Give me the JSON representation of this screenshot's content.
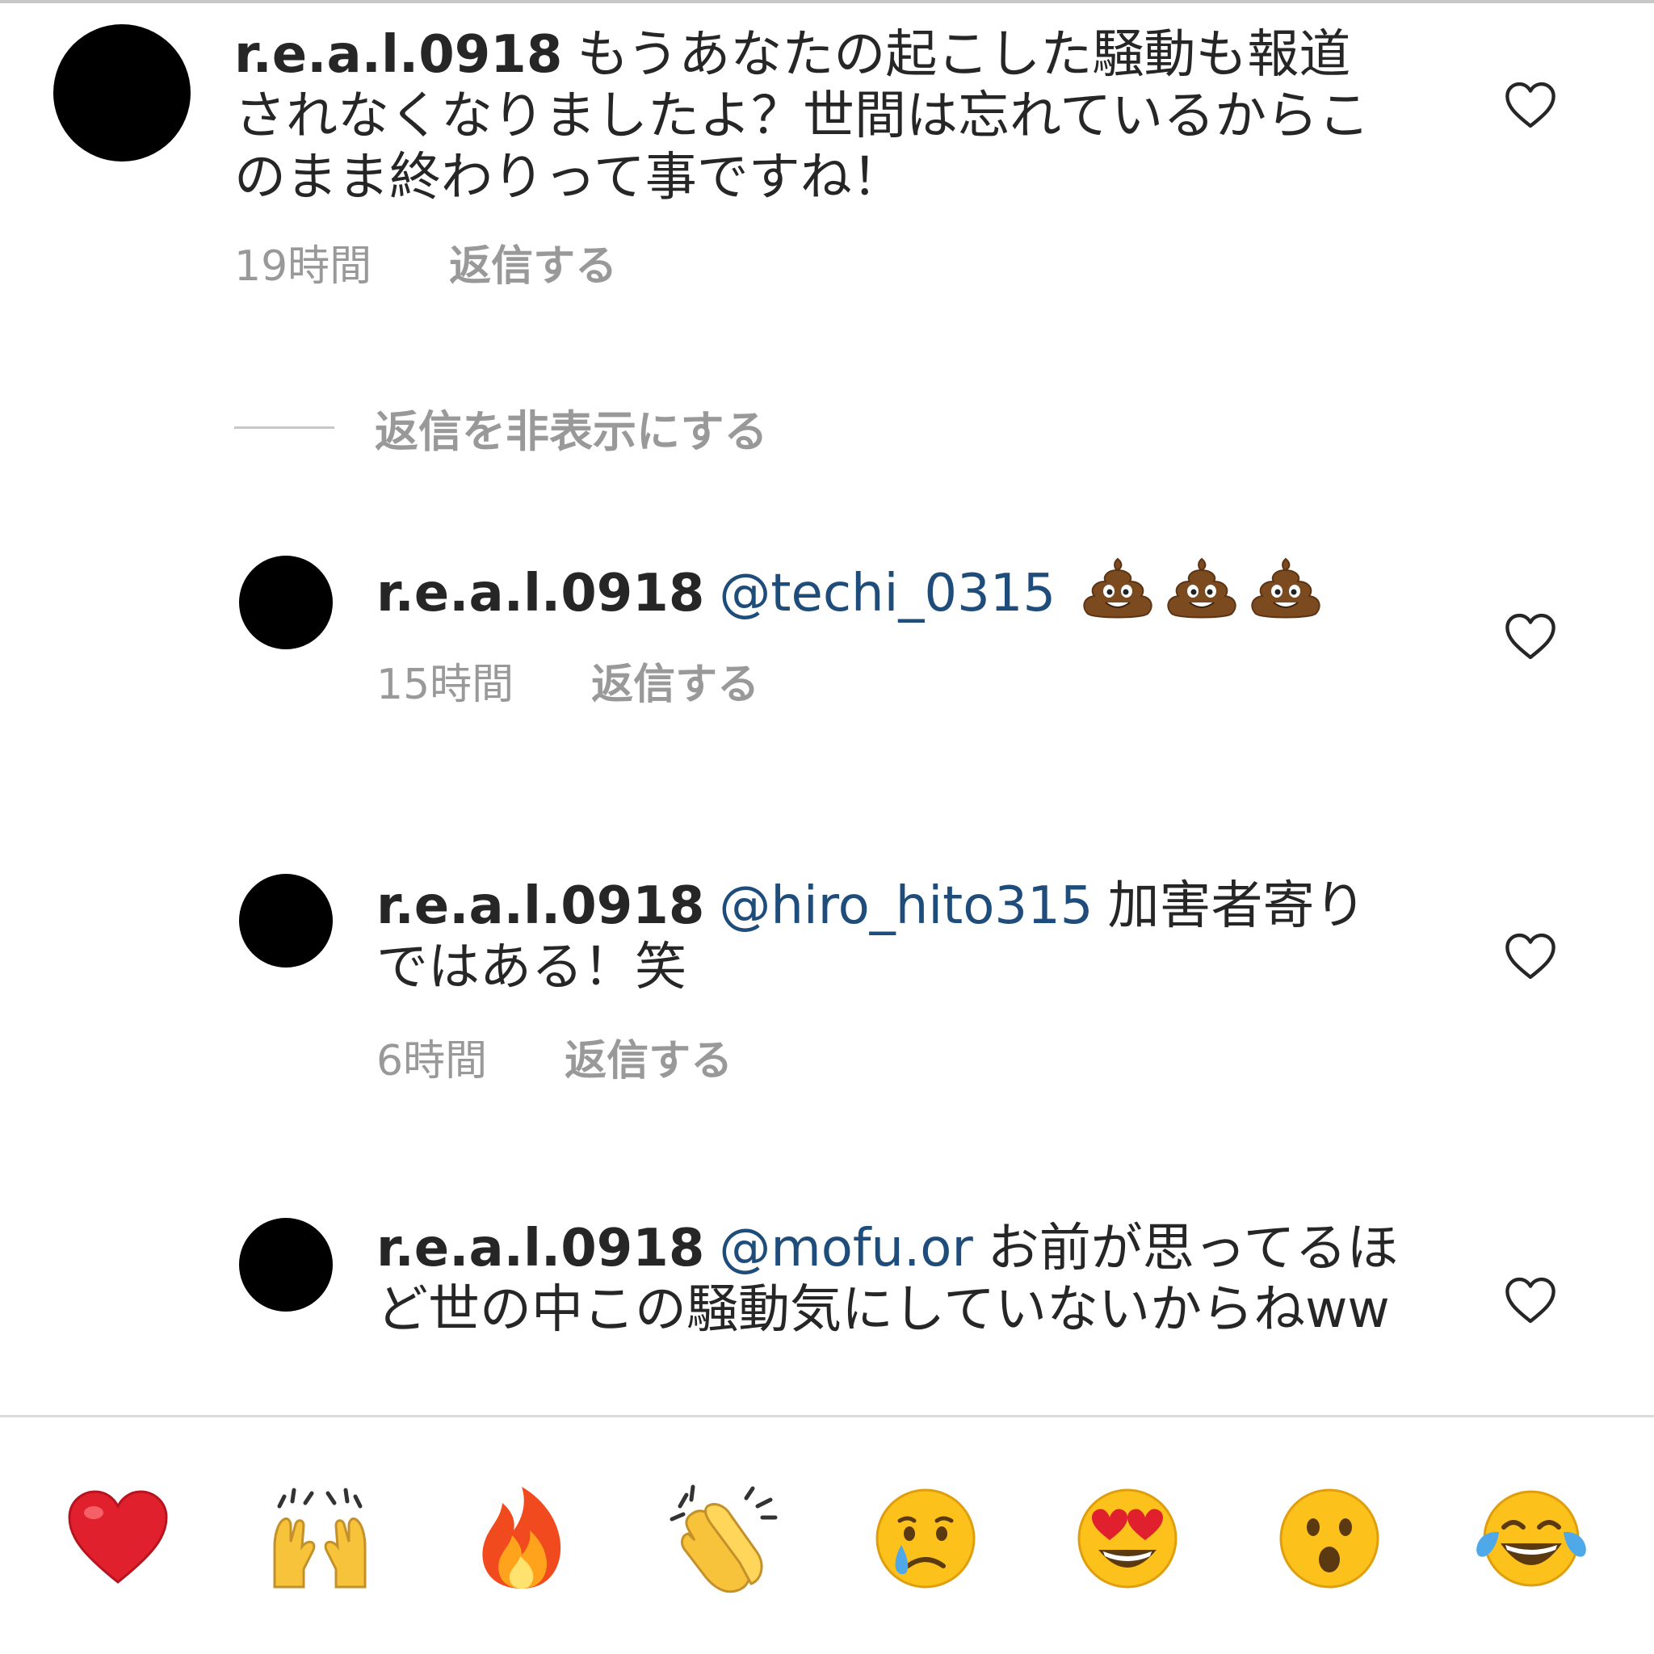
{
  "comments": [
    {
      "username": "r.e.a.l.0918",
      "mention": "",
      "text": "もうあなたの起こした騒動も報道されなくなりましたよ？世間は忘れているからこのまま終わりって事ですね！",
      "time": "19時間",
      "reply_label": "返信する"
    },
    {
      "username": "r.e.a.l.0918",
      "mention": "@techi_0315",
      "text": "",
      "emoji": "pile-of-poo x3",
      "time": "15時間",
      "reply_label": "返信する"
    },
    {
      "username": "r.e.a.l.0918",
      "mention": "@hiro_hito315",
      "text": "加害者寄りではある！笑",
      "time": "6時間",
      "reply_label": "返信する"
    },
    {
      "username": "r.e.a.l.0918",
      "mention": "@mofu.or",
      "text": "お前が思ってるほど世の中この騒動気にしていないからねww"
    }
  ],
  "hide_replies_label": "返信を非表示にする",
  "reactions": [
    "red-heart",
    "raising-hands",
    "fire",
    "clapping-hands",
    "crying-face",
    "heart-eyes-face",
    "surprised-face",
    "tears-of-joy-face"
  ],
  "colors": {
    "text": "#262626",
    "mention": "#1e4d7b",
    "meta": "#999999",
    "avatar": "#000000",
    "divider": "#dbdbdb"
  }
}
